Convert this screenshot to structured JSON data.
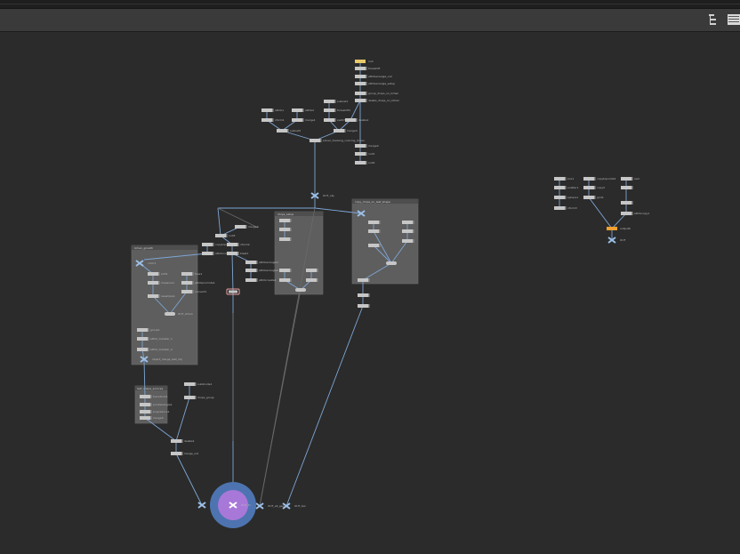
{
  "toolbar": {
    "tree_view_icon": "tree-view-icon",
    "list_view_icon": "list-view-icon"
  },
  "colors": {
    "background": "#2b2b2b",
    "wire": "#7ea6d4",
    "wire_dim": "#5a5a5a",
    "node": "#c6c6c6",
    "network_box": "#5e5e5e",
    "display_flag": "#f0a030",
    "folder_node": "#e8c86a",
    "selected_ring": "#4d74b0",
    "selected_core": "#a878d8"
  },
  "node_labels": {
    "n_top_null": "null",
    "n_top_2": "timeshift",
    "n_top_3": "attribwrangle_cull",
    "n_top_4": "attribwrangle_setup",
    "n_top_5": "group_drops_on_lichen",
    "n_top_6": "delete_drops_on_lichen",
    "n_a1": "attrib1",
    "n_a2": "xform1",
    "n_a3": "attrib2",
    "n_a4": "merge1",
    "n_a5": "subnet1",
    "n_a6": "timeshift1",
    "n_a7": "switch1",
    "n_a8": "delete1",
    "n_a9": "subnet2",
    "n_a10": "merge3",
    "n_a11": "solver_tracking_coloring_lichen",
    "n_b1": "merge2",
    "n_b2": "null1",
    "n_b3": "null2",
    "n_c_obj": "OUT_obj",
    "n_d1": "merge4",
    "n_d2": "null3",
    "n_d3": "copytopoints1",
    "n_d4": "xform2",
    "n_d5": "attribnoise1",
    "n_d6": "blast1",
    "n_d7": "attribwrangle1",
    "n_d8": "attribwrangle2",
    "n_d9": "attribcreate1",
    "n_r1": "box1",
    "n_r2": "scatter1",
    "n_r3": "sphere1",
    "n_r4": "xform3",
    "n_r5": "copytopoints2",
    "n_r6": "copy2",
    "n_r7": "grid1",
    "n_r8": "rest",
    "n_r9": "attribcopy1",
    "n_r10": "output0",
    "n_r11": "OUT",
    "n_l1": "color1",
    "n_l2": "add1",
    "n_l3": "measure1",
    "n_l4": "fuse1",
    "n_l5": "attribpromote1",
    "n_l6": "convert1",
    "n_l7": "resample1",
    "n_l8": "OUT_lichen",
    "n_l9": "group1",
    "n_g1": "attrib_transfer_1",
    "n_g2": "attrib_transfer_2",
    "n_s1": "object_merge_leaf_obj",
    "n_s2": "transform1",
    "n_s3": "pointwrangle1",
    "n_s4": "polyreduce1",
    "n_s5": "merge5",
    "n_m1": "subdivide1",
    "n_m2": "drops_group",
    "n_m3": "delete2",
    "n_m4": "merge_out",
    "n_o1": "OUT_lichen_drops",
    "n_o2": "OUT_all_geo",
    "n_o3": "OUT_tex",
    "n_o4": "OUT_fx"
  },
  "box_titles": {
    "box_lichen": "lichen_growth",
    "box_mid": "drops_setup",
    "box_right": "copy_drops_on_leaf_shape",
    "box_small": "leaf_shape_sources"
  }
}
